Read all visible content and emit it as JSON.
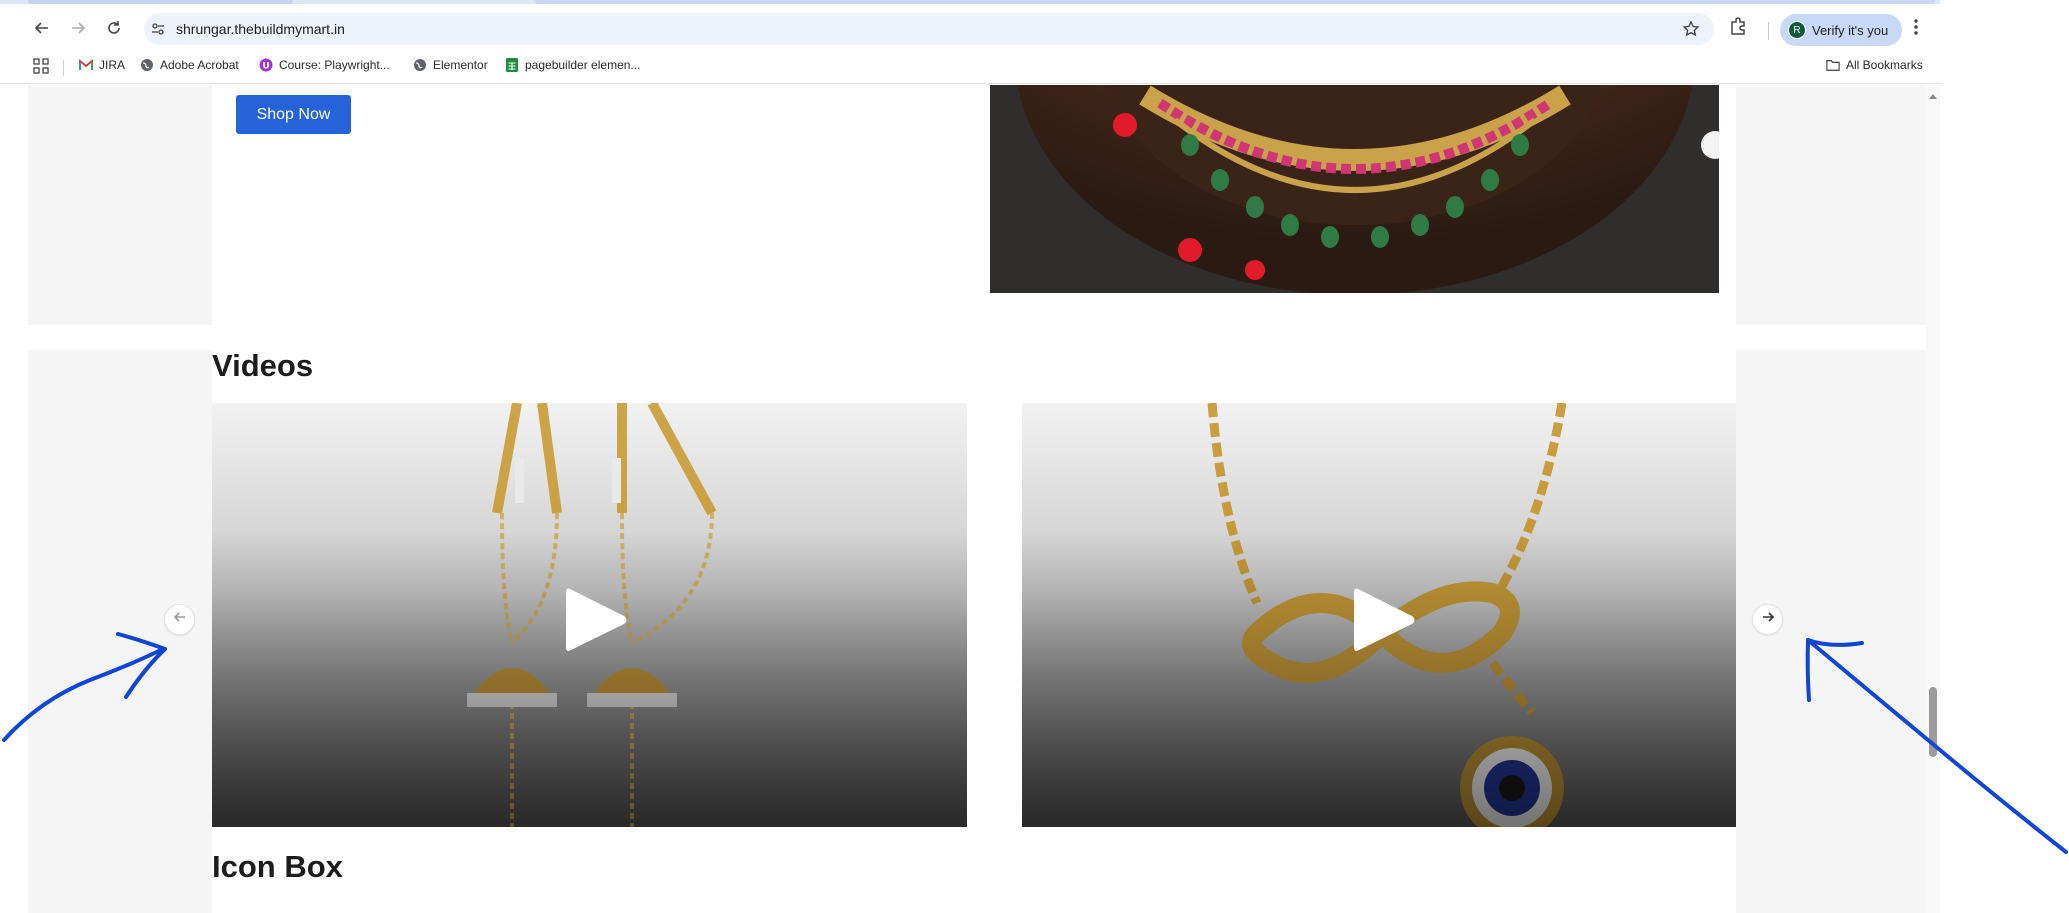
{
  "browser": {
    "url": "shrungar.thebuildmymart.in",
    "profile_button": "Verify it's you",
    "profile_initial": "R",
    "icons": [
      "back-icon",
      "forward-icon",
      "reload-icon",
      "site-settings-icon",
      "star-icon",
      "extensions-icon",
      "kebab-menu-icon"
    ]
  },
  "bookmarks": {
    "items": [
      {
        "label": "JIRA",
        "icon": "gmail-icon"
      },
      {
        "label": "Adobe Acrobat",
        "icon": "globe-icon"
      },
      {
        "label": "Course: Playwright...",
        "icon": "course-icon"
      },
      {
        "label": "Elementor",
        "icon": "globe-icon"
      },
      {
        "label": "pagebuilder elemen...",
        "icon": "sheets-icon"
      }
    ],
    "all_bookmarks": "All Bookmarks"
  },
  "page": {
    "shop_now": "Shop Now",
    "videos_heading": "Videos",
    "iconbox_heading": "Icon Box"
  },
  "colors": {
    "accent": "#2563d8",
    "annotation": "#1046d6"
  }
}
